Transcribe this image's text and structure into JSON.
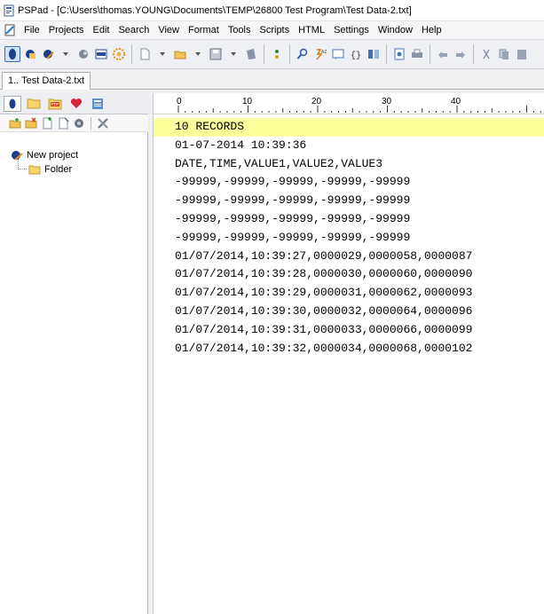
{
  "window": {
    "title": "PSPad - [C:\\Users\\thomas.YOUNG\\Documents\\TEMP\\26800 Test Program\\Test Data-2.txt]"
  },
  "menu": {
    "items": [
      "File",
      "Projects",
      "Edit",
      "Search",
      "View",
      "Format",
      "Tools",
      "Scripts",
      "HTML",
      "Settings",
      "Window",
      "Help"
    ]
  },
  "toolbar": {
    "icons": [
      "project-icon",
      "open-project-icon",
      "new-project-icon",
      "dropdown-icon",
      "clip-icon",
      "log-icon",
      "settings-icon",
      "new-file-icon",
      "open-file-icon",
      "save-icon",
      "save-all-icon",
      "browse-icon",
      "find-icon",
      "replace-icon",
      "bookmark-icon",
      "brackets-icon",
      "compare-icon",
      "preview-icon",
      "print-icon",
      "undo-icon",
      "redo-icon",
      "cut-icon",
      "copy-icon",
      "paste-icon"
    ]
  },
  "tabs": [
    {
      "label": "1.. Test Data-2.txt",
      "active": true
    }
  ],
  "left_panel": {
    "tab_icons": [
      "project-tab-icon",
      "folder-tab-icon",
      "ftp-tab-icon",
      "favorites-tab-icon",
      "clipboard-tab-icon"
    ],
    "tool_icons": [
      "add-file-icon",
      "add-folder-icon",
      "add-files-icon",
      "remove-icon",
      "settings-icon",
      "tools-icon"
    ],
    "tree": {
      "root": "New project",
      "children": [
        "Folder"
      ]
    }
  },
  "ruler": {
    "labels": [
      "0",
      "10",
      "20",
      "30",
      "40"
    ]
  },
  "editor": {
    "lines": [
      "10 RECORDS",
      "01-07-2014 10:39:36",
      "DATE,TIME,VALUE1,VALUE2,VALUE3",
      "-99999,-99999,-99999,-99999,-99999",
      "-99999,-99999,-99999,-99999,-99999",
      "-99999,-99999,-99999,-99999,-99999",
      "-99999,-99999,-99999,-99999,-99999",
      "01/07/2014,10:39:27,0000029,0000058,0000087",
      "01/07/2014,10:39:28,0000030,0000060,0000090",
      "01/07/2014,10:39:29,0000031,0000062,0000093",
      "01/07/2014,10:39:30,0000032,0000064,0000096",
      "01/07/2014,10:39:31,0000033,0000066,0000099",
      "01/07/2014,10:39:32,0000034,0000068,0000102"
    ],
    "current_line_color": "#ffff9b"
  },
  "colors": {
    "accent": "#3d6fb6",
    "toolbar_bg": "#eef0f3"
  }
}
